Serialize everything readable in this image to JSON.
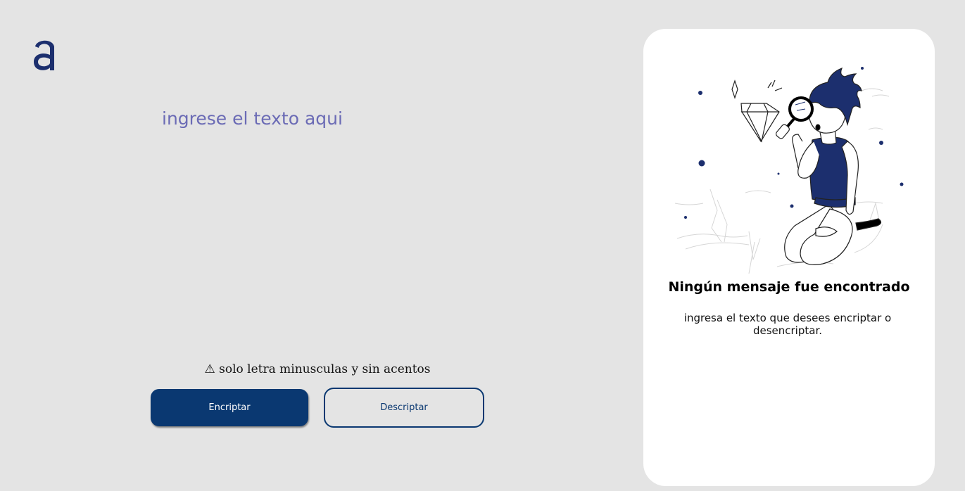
{
  "logo": {
    "name": "alura-logo",
    "color": "#1c2f6e"
  },
  "input": {
    "placeholder": "ingrese el texto aqui",
    "value": ""
  },
  "warning": {
    "icon": "⚠",
    "text": "solo letra minusculas y sin acentos"
  },
  "buttons": {
    "encrypt_label": "Encriptar",
    "decrypt_label": "Descriptar"
  },
  "output_panel": {
    "illustration": "boy-with-magnifying-glass-illustration",
    "title": "Ningún mensaje fue encontrado",
    "message": "ingresa el texto que desees encriptar o desencriptar."
  },
  "colors": {
    "background": "#e4e4e4",
    "primary": "#0a3871",
    "placeholder": "#6b6bb5",
    "panel": "#ffffff",
    "illustration_accent": "#1c2f6e"
  }
}
